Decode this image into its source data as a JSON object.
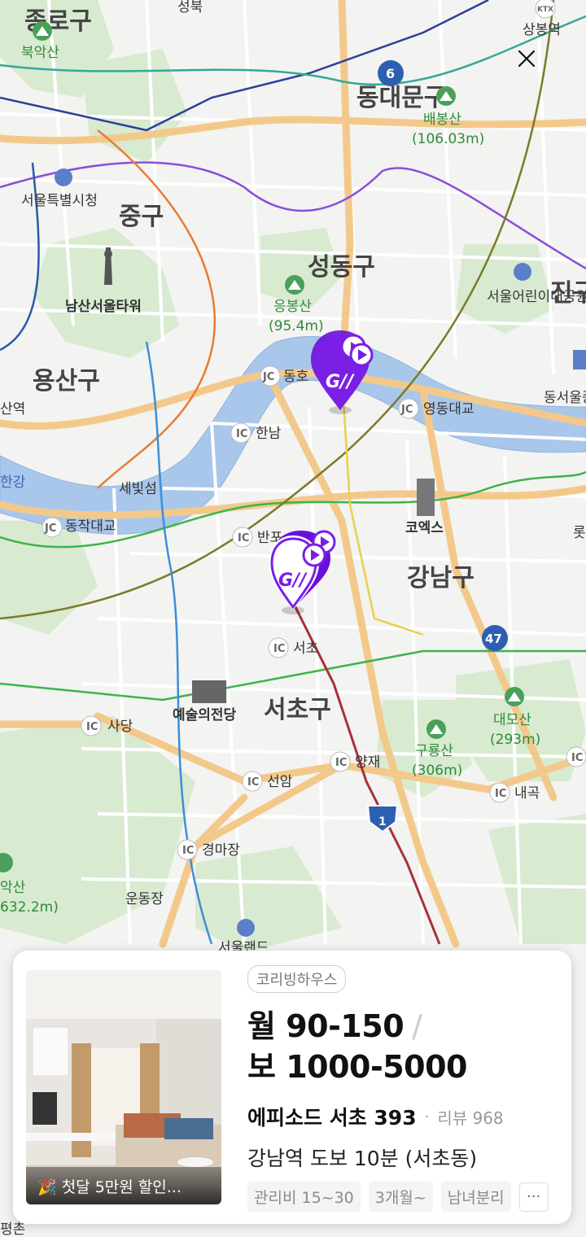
{
  "map": {
    "labels": {
      "jongno": "종로구",
      "seongbuk_top": "성북",
      "bugaksan": "북악산",
      "dongdaemun": "동대문구",
      "baebongsan": "배봉산",
      "baebongsan_height": "(106.03m)",
      "sangbong": "상봉역",
      "city_hall": "서울특별시청",
      "junggu": "중구",
      "seongdong": "성동구",
      "namsan_tower": "남산서울타워",
      "eungbongsan": "응봉산",
      "eungbongsan_height": "(95.4m)",
      "childrens_park": "서울어린이대공원",
      "gwangjin_partial": "진구",
      "yongsan": "용산구",
      "yongsan_station": "산역",
      "dongho": "동호",
      "yeongdong_bridge": "영동대교",
      "east_terminal": "동서울종합터",
      "hannam": "한남",
      "han_river_partial": "한강",
      "sebitseom": "세빛섬",
      "dongjak_bridge": "동작대교",
      "banpo": "반포",
      "coex": "코엑스",
      "lotte_partial": "롯",
      "gangnam": "강남구",
      "seocho_ic": "서초",
      "arts_center": "예술의전당",
      "seocho": "서초구",
      "daemosan": "대모산",
      "daemosan_height": "(293m)",
      "sadang": "사당",
      "guryongsan": "구룡산",
      "guryongsan_height": "(306m)",
      "yangjae": "양재",
      "seonam": "선암",
      "naegok": "내곡",
      "gyeongmajang": "경마장",
      "gwanaksan_partial": "악산",
      "gwanaksan_height_partial": "632.2m)",
      "undongjang": "운동장",
      "seoul_land": "서울랜드",
      "pyeongchon_partial": "평촌",
      "route6": "6",
      "route47": "47",
      "route1": "1",
      "jc": "JC",
      "ic": "IC",
      "ktx": "KTX"
    }
  },
  "close_icon": "close-icon",
  "card": {
    "brand_tag": "코리빙하우스",
    "price_monthly": "월 90-150",
    "price_sep": "/",
    "price_deposit": "보 1000-5000",
    "name": "에피소드 서초 393",
    "dot": "·",
    "review": "리뷰 968",
    "location": "강남역 도보 10분 (서초동)",
    "promo": "🎉 첫달 5만원 할인...",
    "chips": [
      "관리비 15~30",
      "3개월~",
      "남녀분리"
    ],
    "more": "···"
  },
  "colors": {
    "marker_purple": "#7a1fe6",
    "marker_dark": "#6a10d9",
    "river": "#a9c7ea",
    "park": "#d9ebd2",
    "arterial": "#f3c98b",
    "line2_green": "#3cb44a",
    "line_purple": "#8a4fd9",
    "line_orange": "#e87b34"
  }
}
